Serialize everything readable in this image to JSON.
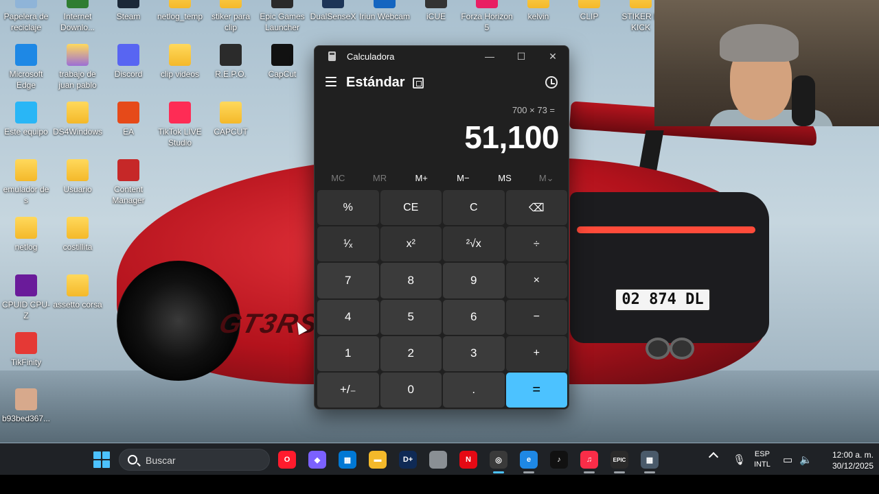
{
  "desktop": {
    "icons": [
      {
        "label": "Papelera de reciclaje",
        "icon": "recycle-bin-icon",
        "color": "#8fb4d8"
      },
      {
        "label": "Internet Downlo...",
        "icon": "download-manager-icon",
        "color": "#2f7d32"
      },
      {
        "label": "Steam",
        "icon": "steam-icon",
        "color": "#1b2838"
      },
      {
        "label": "netlog_temp",
        "icon": "folder-icon",
        "color": "#f4b92a"
      },
      {
        "label": "stiker para clip",
        "icon": "folder-icon",
        "color": "#f4b92a"
      },
      {
        "label": "Epic Games Launcher",
        "icon": "epic-games-icon",
        "color": "#2a2a2a"
      },
      {
        "label": "DualSenseX",
        "icon": "dualsensex-icon",
        "color": "#1d3557"
      },
      {
        "label": "Iriun Webcam",
        "icon": "iriun-webcam-icon",
        "color": "#1565c0"
      },
      {
        "label": "iCUE",
        "icon": "icue-icon",
        "color": "#333333"
      },
      {
        "label": "Forza Horizon 5",
        "icon": "forza-icon",
        "color": "#e91e63"
      },
      {
        "label": "kelvin",
        "icon": "folder-icon",
        "color": "#f4b92a"
      },
      {
        "label": "CLIP",
        "icon": "folder-icon",
        "color": "#f4b92a"
      },
      {
        "label": "STIKER D KICK",
        "icon": "folder-icon",
        "color": "#f4b92a"
      },
      {
        "label": "Microsoft Edge",
        "icon": "edge-icon",
        "color": "#1e88e5"
      },
      {
        "label": "trabajo de juan pablo",
        "icon": "folder-icon",
        "color": "#9c6ed6"
      },
      {
        "label": "Discord",
        "icon": "discord-icon",
        "color": "#5865f2"
      },
      {
        "label": "clip videos",
        "icon": "folder-icon",
        "color": "#f4b92a"
      },
      {
        "label": "R.E.P.O.",
        "icon": "repo-game-icon",
        "color": "#2b2b2b"
      },
      {
        "label": "CapCut",
        "icon": "capcut-icon",
        "color": "#111111"
      },
      {
        "label": "Este equipo",
        "icon": "this-pc-icon",
        "color": "#29b6f6"
      },
      {
        "label": "DS4Windows",
        "icon": "folder-icon",
        "color": "#f4b92a"
      },
      {
        "label": "EA",
        "icon": "ea-icon",
        "color": "#e64a19"
      },
      {
        "label": "TikTok LIVE Studio",
        "icon": "tiktok-live-icon",
        "color": "#fe2c55"
      },
      {
        "label": "CAPCUT",
        "icon": "folder-icon",
        "color": "#f4b92a"
      },
      {
        "label": "emulador de s",
        "icon": "folder-icon",
        "color": "#f4b92a"
      },
      {
        "label": "Usuario",
        "icon": "folder-icon",
        "color": "#f4b92a"
      },
      {
        "label": "Content Manager",
        "icon": "content-manager-icon",
        "color": "#c62828"
      },
      {
        "label": "netlog",
        "icon": "folder-icon",
        "color": "#f4b92a"
      },
      {
        "label": "costillita",
        "icon": "folder-icon",
        "color": "#f4b92a"
      },
      {
        "label": "CPUID CPU-Z",
        "icon": "cpuz-icon",
        "color": "#6a1b9a"
      },
      {
        "label": "assetto corsa",
        "icon": "folder-icon",
        "color": "#f4b92a"
      },
      {
        "label": "TikFinity",
        "icon": "tikfinity-icon",
        "color": "#e53935"
      },
      {
        "label": "b93bed367...",
        "icon": "image-thumbnail-icon",
        "color": "#d7a98c"
      }
    ],
    "plate_text": "02 874 DL",
    "car_logo": "GT3RS"
  },
  "calculator": {
    "window_title": "Calculadora",
    "mode": "Estándar",
    "expression": "700 × 73 =",
    "result": "51,100",
    "memory": [
      {
        "label": "MC",
        "enabled": false
      },
      {
        "label": "MR",
        "enabled": false
      },
      {
        "label": "M+",
        "enabled": true
      },
      {
        "label": "M−",
        "enabled": true
      },
      {
        "label": "MS",
        "enabled": true
      },
      {
        "label": "M⌄",
        "enabled": false
      }
    ],
    "keys": [
      "%",
      "CE",
      "C",
      "⌫",
      "¹⁄ₓ",
      "x²",
      "²√x",
      "÷",
      "7",
      "8",
      "9",
      "×",
      "4",
      "5",
      "6",
      "−",
      "1",
      "2",
      "3",
      "+",
      "+/₋",
      "0",
      ".",
      "="
    ],
    "accent": "#4cc2ff"
  },
  "taskbar": {
    "search_placeholder": "Buscar",
    "apps": [
      {
        "name": "opera-icon",
        "glyph": "O",
        "color": "#ff1b2d"
      },
      {
        "name": "copilot-icon",
        "glyph": "◆",
        "color": "#7b61ff"
      },
      {
        "name": "store-icon",
        "glyph": "▦",
        "color": "#0078d4"
      },
      {
        "name": "file-explorer-icon",
        "glyph": "▬",
        "color": "#f4b92a"
      },
      {
        "name": "disney-plus-icon",
        "glyph": "D+",
        "color": "#0f2a55"
      },
      {
        "name": "blank-app-icon",
        "glyph": "",
        "color": "#8a8f94"
      },
      {
        "name": "netflix-icon",
        "glyph": "N",
        "color": "#e50914"
      },
      {
        "name": "obs-icon",
        "glyph": "◎",
        "color": "#3a3a3a"
      },
      {
        "name": "edge-icon",
        "glyph": "e",
        "color": "#1e88e5"
      },
      {
        "name": "tiktok-icon",
        "glyph": "♪",
        "color": "#111111"
      },
      {
        "name": "apple-music-icon",
        "glyph": "♫",
        "color": "#fa2d48"
      },
      {
        "name": "epic-games-icon",
        "glyph": "EPIC",
        "color": "#2a2a2a"
      },
      {
        "name": "calculator-icon",
        "glyph": "▦",
        "color": "#4a5a6a"
      }
    ],
    "language": "ESP",
    "layout": "INTL",
    "time": "12:00 a. m.",
    "date": "30/12/2025"
  }
}
